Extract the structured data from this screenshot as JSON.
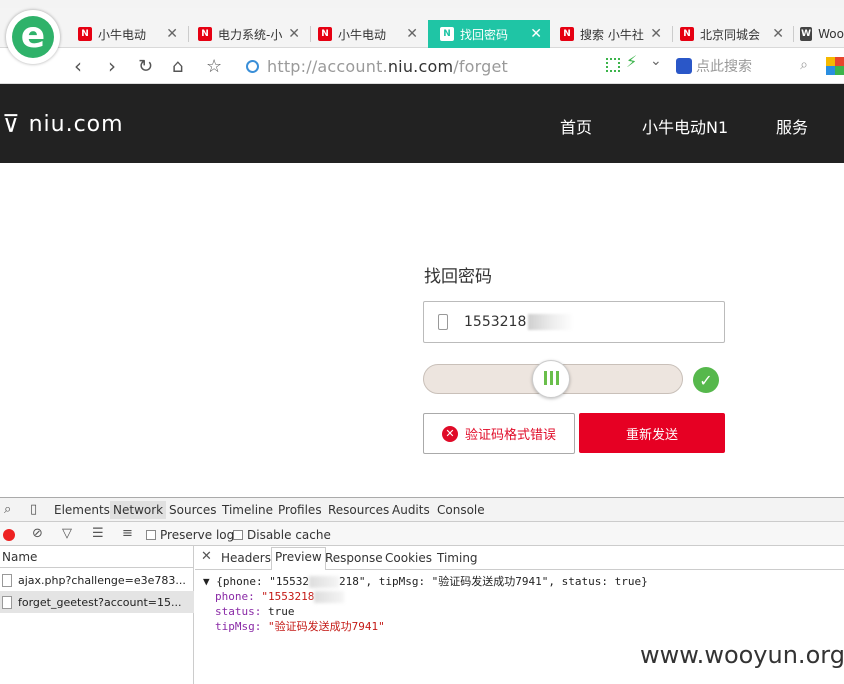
{
  "browser": {
    "tabs": [
      {
        "label": "小牛电动",
        "active": false
      },
      {
        "label": "电力系统-小",
        "active": false
      },
      {
        "label": "小牛电动",
        "active": false
      },
      {
        "label": "找回密码",
        "active": true
      },
      {
        "label": "搜索 小牛社",
        "active": false
      },
      {
        "label": "北京同城会",
        "active": false
      },
      {
        "label": "Woo",
        "active": false
      }
    ],
    "url_scheme": "http://account.",
    "url_domain": "niu.com",
    "url_path": "/forget",
    "search_placeholder": "点此搜索",
    "accent_color": "#1fc5a5"
  },
  "site": {
    "brand": "niu.com",
    "menu": [
      "首页",
      "小牛电动N1",
      "服务"
    ]
  },
  "form": {
    "title": "找回密码",
    "phone_value": "1553218",
    "slider_progress": 0.49,
    "error_label": "验证码格式错误",
    "resend_label": "重新发送",
    "brand_red": "#e60023"
  },
  "devtools": {
    "tabs": [
      "Elements",
      "Network",
      "Sources",
      "Timeline",
      "Profiles",
      "Resources",
      "Audits",
      "Console"
    ],
    "selected_tab": "Network",
    "preserve_log": "Preserve log",
    "disable_cache": "Disable cache",
    "name_header": "Name",
    "requests": [
      {
        "name": "ajax.php?challenge=e3e783...",
        "selected": false
      },
      {
        "name": "forget_geetest?account=15...",
        "selected": true
      }
    ],
    "detail_tabs": [
      "Headers",
      "Preview",
      "Response",
      "Cookies",
      "Timing"
    ],
    "selected_detail": "Preview",
    "preview": {
      "summary_a": "▼ {phone: \"15532",
      "summary_b": "218\", tipMsg: \"验证码发送成功7941\", status: true}",
      "phone_key": "phone: ",
      "phone_val": "\"1553218",
      "status_key": "status: ",
      "status_val": "true",
      "tip_key": "tipMsg: ",
      "tip_val": "\"验证码发送成功7941\""
    }
  },
  "watermark": "www.wooyun.org"
}
